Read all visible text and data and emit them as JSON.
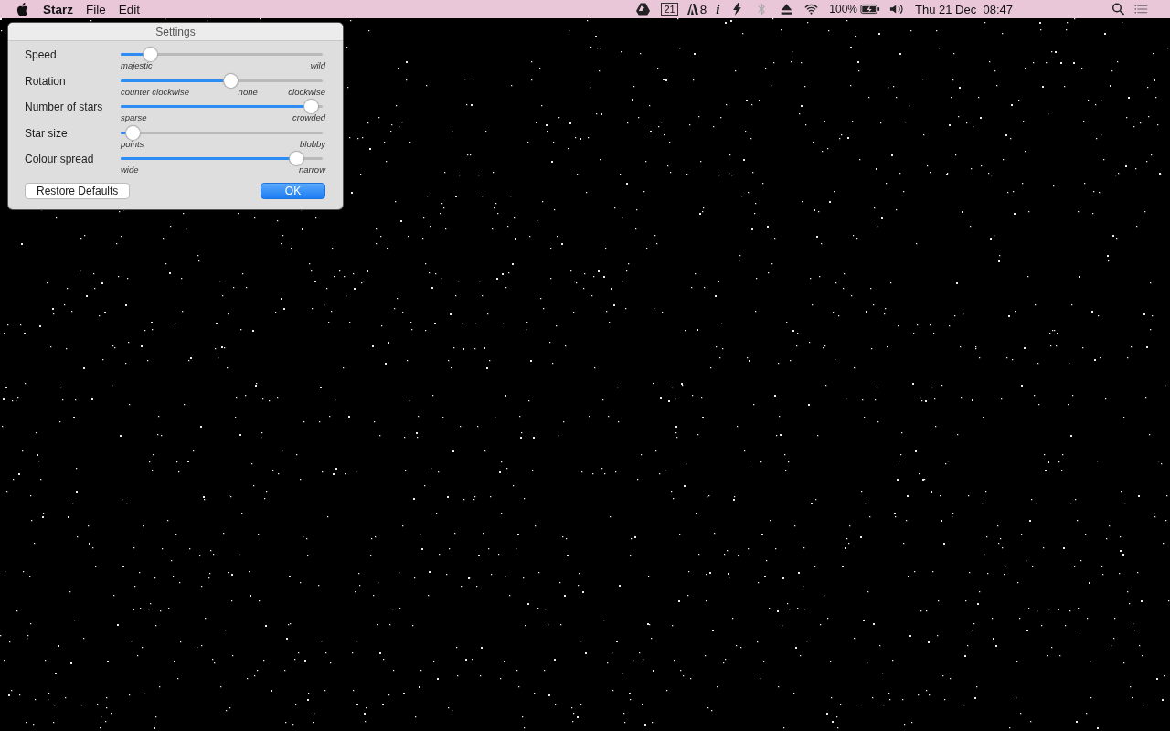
{
  "menu_bar": {
    "app_name": "Starz",
    "menus": [
      "File",
      "Edit"
    ],
    "status": {
      "calendar_day": "21",
      "adobe_count": "8",
      "info": "i",
      "battery_percent": "100%",
      "clock": "Thu 21 Dec  08:47"
    }
  },
  "dialog": {
    "title": "Settings",
    "sliders": [
      {
        "label": "Speed",
        "level": 0.12,
        "scale": [
          "majestic",
          "wild"
        ]
      },
      {
        "label": "Rotation",
        "level": 0.55,
        "scale": [
          "counter clockwise",
          "none",
          "clockwise"
        ]
      },
      {
        "label": "Number of stars",
        "level": 0.98,
        "scale": [
          "sparse",
          "crowded"
        ]
      },
      {
        "label": "Star size",
        "level": 0.03,
        "scale": [
          "points",
          "blobby"
        ]
      },
      {
        "label": "Colour spread",
        "level": 0.9,
        "scale": [
          "wide",
          "narrow"
        ]
      }
    ],
    "buttons": [
      {
        "label": "Restore Defaults",
        "kind": "secondary"
      },
      {
        "label": "OK",
        "kind": "primary"
      }
    ]
  }
}
